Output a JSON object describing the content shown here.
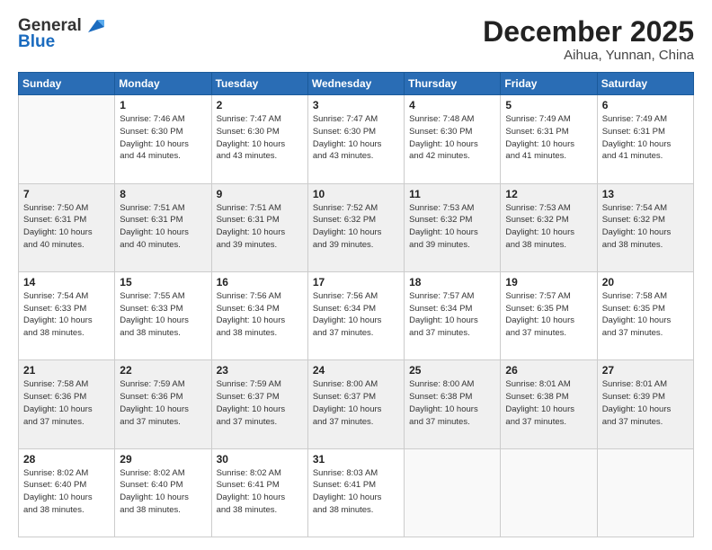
{
  "header": {
    "logo_line1": "General",
    "logo_line2": "Blue",
    "month": "December 2025",
    "location": "Aihua, Yunnan, China"
  },
  "weekdays": [
    "Sunday",
    "Monday",
    "Tuesday",
    "Wednesday",
    "Thursday",
    "Friday",
    "Saturday"
  ],
  "weeks": [
    [
      {
        "day": "",
        "info": ""
      },
      {
        "day": "1",
        "info": "Sunrise: 7:46 AM\nSunset: 6:30 PM\nDaylight: 10 hours\nand 44 minutes."
      },
      {
        "day": "2",
        "info": "Sunrise: 7:47 AM\nSunset: 6:30 PM\nDaylight: 10 hours\nand 43 minutes."
      },
      {
        "day": "3",
        "info": "Sunrise: 7:47 AM\nSunset: 6:30 PM\nDaylight: 10 hours\nand 43 minutes."
      },
      {
        "day": "4",
        "info": "Sunrise: 7:48 AM\nSunset: 6:30 PM\nDaylight: 10 hours\nand 42 minutes."
      },
      {
        "day": "5",
        "info": "Sunrise: 7:49 AM\nSunset: 6:31 PM\nDaylight: 10 hours\nand 41 minutes."
      },
      {
        "day": "6",
        "info": "Sunrise: 7:49 AM\nSunset: 6:31 PM\nDaylight: 10 hours\nand 41 minutes."
      }
    ],
    [
      {
        "day": "7",
        "info": "Sunrise: 7:50 AM\nSunset: 6:31 PM\nDaylight: 10 hours\nand 40 minutes."
      },
      {
        "day": "8",
        "info": "Sunrise: 7:51 AM\nSunset: 6:31 PM\nDaylight: 10 hours\nand 40 minutes."
      },
      {
        "day": "9",
        "info": "Sunrise: 7:51 AM\nSunset: 6:31 PM\nDaylight: 10 hours\nand 39 minutes."
      },
      {
        "day": "10",
        "info": "Sunrise: 7:52 AM\nSunset: 6:32 PM\nDaylight: 10 hours\nand 39 minutes."
      },
      {
        "day": "11",
        "info": "Sunrise: 7:53 AM\nSunset: 6:32 PM\nDaylight: 10 hours\nand 39 minutes."
      },
      {
        "day": "12",
        "info": "Sunrise: 7:53 AM\nSunset: 6:32 PM\nDaylight: 10 hours\nand 38 minutes."
      },
      {
        "day": "13",
        "info": "Sunrise: 7:54 AM\nSunset: 6:32 PM\nDaylight: 10 hours\nand 38 minutes."
      }
    ],
    [
      {
        "day": "14",
        "info": "Sunrise: 7:54 AM\nSunset: 6:33 PM\nDaylight: 10 hours\nand 38 minutes."
      },
      {
        "day": "15",
        "info": "Sunrise: 7:55 AM\nSunset: 6:33 PM\nDaylight: 10 hours\nand 38 minutes."
      },
      {
        "day": "16",
        "info": "Sunrise: 7:56 AM\nSunset: 6:34 PM\nDaylight: 10 hours\nand 38 minutes."
      },
      {
        "day": "17",
        "info": "Sunrise: 7:56 AM\nSunset: 6:34 PM\nDaylight: 10 hours\nand 37 minutes."
      },
      {
        "day": "18",
        "info": "Sunrise: 7:57 AM\nSunset: 6:34 PM\nDaylight: 10 hours\nand 37 minutes."
      },
      {
        "day": "19",
        "info": "Sunrise: 7:57 AM\nSunset: 6:35 PM\nDaylight: 10 hours\nand 37 minutes."
      },
      {
        "day": "20",
        "info": "Sunrise: 7:58 AM\nSunset: 6:35 PM\nDaylight: 10 hours\nand 37 minutes."
      }
    ],
    [
      {
        "day": "21",
        "info": "Sunrise: 7:58 AM\nSunset: 6:36 PM\nDaylight: 10 hours\nand 37 minutes."
      },
      {
        "day": "22",
        "info": "Sunrise: 7:59 AM\nSunset: 6:36 PM\nDaylight: 10 hours\nand 37 minutes."
      },
      {
        "day": "23",
        "info": "Sunrise: 7:59 AM\nSunset: 6:37 PM\nDaylight: 10 hours\nand 37 minutes."
      },
      {
        "day": "24",
        "info": "Sunrise: 8:00 AM\nSunset: 6:37 PM\nDaylight: 10 hours\nand 37 minutes."
      },
      {
        "day": "25",
        "info": "Sunrise: 8:00 AM\nSunset: 6:38 PM\nDaylight: 10 hours\nand 37 minutes."
      },
      {
        "day": "26",
        "info": "Sunrise: 8:01 AM\nSunset: 6:38 PM\nDaylight: 10 hours\nand 37 minutes."
      },
      {
        "day": "27",
        "info": "Sunrise: 8:01 AM\nSunset: 6:39 PM\nDaylight: 10 hours\nand 37 minutes."
      }
    ],
    [
      {
        "day": "28",
        "info": "Sunrise: 8:02 AM\nSunset: 6:40 PM\nDaylight: 10 hours\nand 38 minutes."
      },
      {
        "day": "29",
        "info": "Sunrise: 8:02 AM\nSunset: 6:40 PM\nDaylight: 10 hours\nand 38 minutes."
      },
      {
        "day": "30",
        "info": "Sunrise: 8:02 AM\nSunset: 6:41 PM\nDaylight: 10 hours\nand 38 minutes."
      },
      {
        "day": "31",
        "info": "Sunrise: 8:03 AM\nSunset: 6:41 PM\nDaylight: 10 hours\nand 38 minutes."
      },
      {
        "day": "",
        "info": ""
      },
      {
        "day": "",
        "info": ""
      },
      {
        "day": "",
        "info": ""
      }
    ]
  ]
}
